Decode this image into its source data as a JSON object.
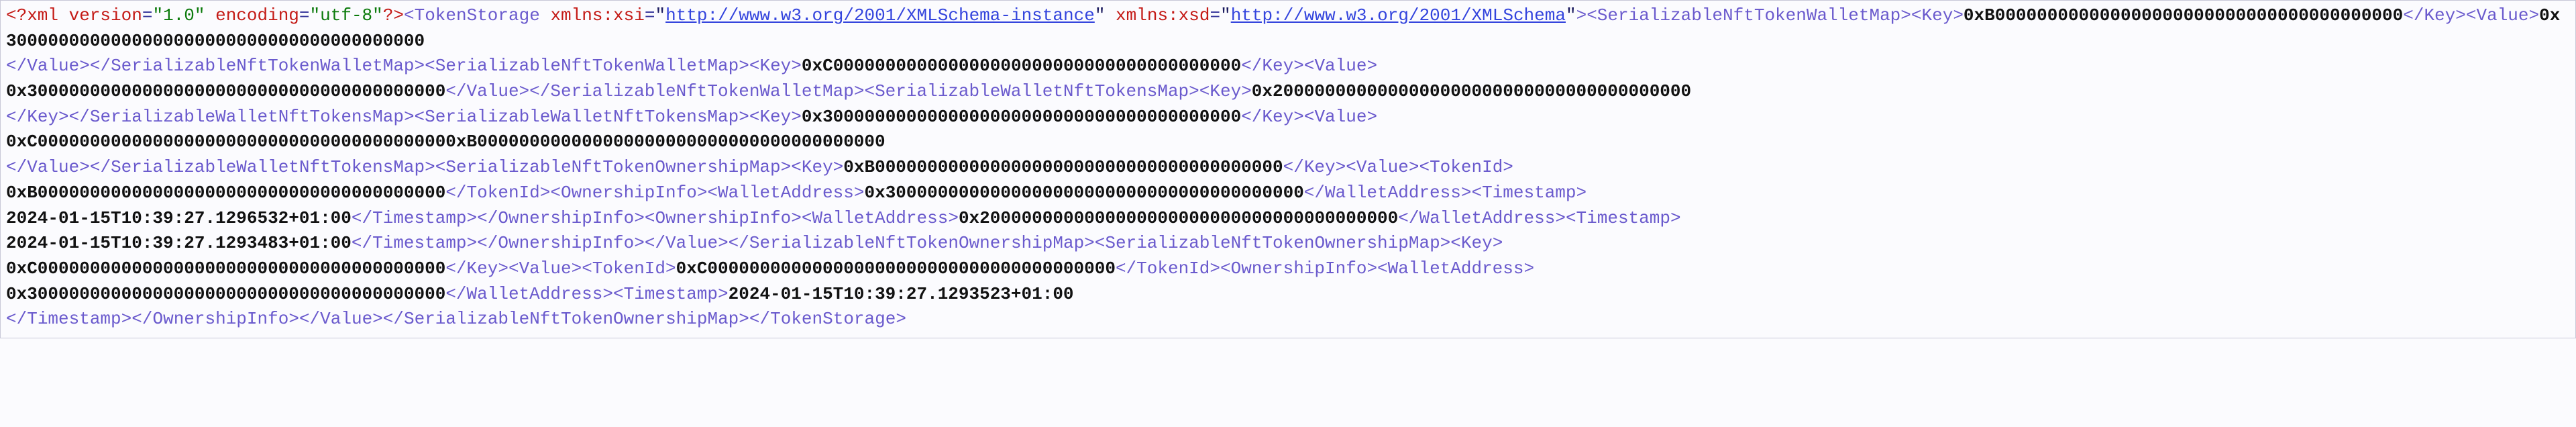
{
  "xml": {
    "declaration": {
      "version": "1.0",
      "encoding": "utf-8"
    },
    "root": {
      "name": "TokenStorage",
      "ns_xsi": "http://www.w3.org/2001/XMLSchema-instance",
      "ns_xsd": "http://www.w3.org/2001/XMLSchema"
    },
    "walletMaps": [
      {
        "key": "0xB000000000000000000000000000000000000000",
        "value": "0x3000000000000000000000000000000000000000"
      },
      {
        "key": "0xC000000000000000000000000000000000000000",
        "value": "0x3000000000000000000000000000000000000000"
      }
    ],
    "walletNftTokensMaps": [
      {
        "key": "0x2000000000000000000000000000000000000000"
      },
      {
        "key": "0x3000000000000000000000000000000000000000",
        "value": "0xC0000000000000000000000000000000000000000xB000000000000000000000000000000000000000"
      }
    ],
    "ownershipMaps": [
      {
        "key": "0xB000000000000000000000000000000000000000",
        "tokenId": "0xB000000000000000000000000000000000000000",
        "ownership": [
          {
            "wallet": "0x3000000000000000000000000000000000000000",
            "timestamp": "2024-01-15T10:39:27.1296532+01:00"
          },
          {
            "wallet": "0x2000000000000000000000000000000000000000",
            "timestamp": "2024-01-15T10:39:27.1293483+01:00"
          }
        ]
      },
      {
        "key": "0xC000000000000000000000000000000000000000",
        "tokenId": "0xC000000000000000000000000000000000000000",
        "ownership": [
          {
            "wallet": "0x3000000000000000000000000000000000000000",
            "timestamp": "2024-01-15T10:39:27.1293523+01:00"
          }
        ]
      }
    ],
    "tags": {
      "map": "SerializableNftTokenWalletMap",
      "tokens": "SerializableWalletNftTokensMap",
      "own": "SerializableNftTokenOwnershipMap",
      "key": "Key",
      "value": "Value",
      "tokenId": "TokenId",
      "ownInfo": "OwnershipInfo",
      "wallet": "WalletAddress",
      "ts": "Timestamp"
    }
  }
}
